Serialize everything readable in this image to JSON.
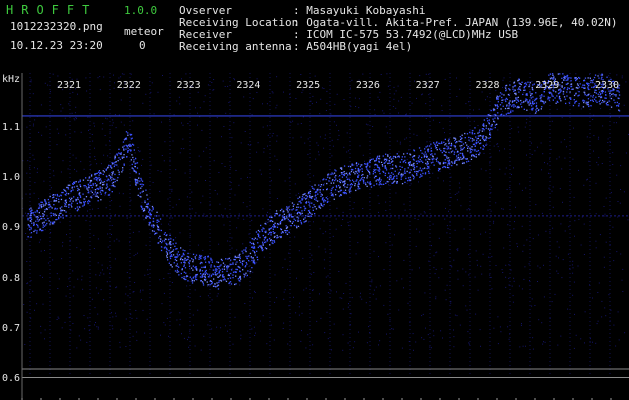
{
  "app": {
    "title": "HROFFT",
    "version": "1.0.0"
  },
  "header": {
    "file": "1012232320.png",
    "datetime": "10.12.23 23:20",
    "meteor_label": "meteor",
    "meteor_count": "0"
  },
  "info": [
    {
      "label": "Ovserver",
      "value": ": Masayuki Kobayashi"
    },
    {
      "label": "Receiving Location",
      "value": ": Ogata-vill. Akita-Pref. JAPAN (139.96E, 40.02N)"
    },
    {
      "label": "Receiver",
      "value": ": ICOM IC-575 53.7492(@LCD)MHz USB"
    },
    {
      "label": "Receiving antenna",
      "value": ": A504HB(yagi 4el)"
    }
  ],
  "colors": {
    "background": "#000000",
    "signal": "#3a50ff",
    "grid": "#1e1e88",
    "text": "#e6e6e6",
    "brand": "#3ec93e"
  },
  "chart_data": {
    "type": "heatmap",
    "ylabel": "kHz",
    "x_ticks": [
      "2321",
      "2322",
      "2323",
      "2324",
      "2325",
      "2326",
      "2327",
      "2328",
      "2329",
      "2330"
    ],
    "y_ticks": [
      "1.1",
      "1.0",
      "0.9",
      "0.8",
      "0.7",
      "0.6"
    ],
    "trace": {
      "x": [
        2320.3,
        2320.6,
        2321.0,
        2321.4,
        2321.7,
        2321.9,
        2322.0,
        2322.1,
        2322.2,
        2322.4,
        2322.6,
        2322.8,
        2323.0,
        2323.2,
        2323.5,
        2323.8,
        2324.0,
        2324.2,
        2324.5,
        2324.8,
        2325.0,
        2325.3,
        2325.6,
        2326.0,
        2326.3,
        2326.6,
        2327.0,
        2327.3,
        2327.6,
        2327.9,
        2328.0,
        2328.2,
        2328.5,
        2328.8,
        2329.0,
        2329.3,
        2329.6,
        2329.9,
        2330.2
      ],
      "y": [
        0.91,
        0.93,
        0.96,
        0.98,
        1.0,
        1.05,
        1.08,
        1.02,
        0.97,
        0.92,
        0.87,
        0.84,
        0.82,
        0.82,
        0.81,
        0.82,
        0.84,
        0.88,
        0.91,
        0.93,
        0.95,
        0.98,
        1.0,
        1.01,
        1.02,
        1.02,
        1.04,
        1.05,
        1.06,
        1.08,
        1.1,
        1.15,
        1.17,
        1.16,
        1.18,
        1.18,
        1.17,
        1.18,
        1.16
      ]
    },
    "horizontal_lines_khz": [
      1.124,
      0.925,
      0.62,
      0.603
    ]
  }
}
